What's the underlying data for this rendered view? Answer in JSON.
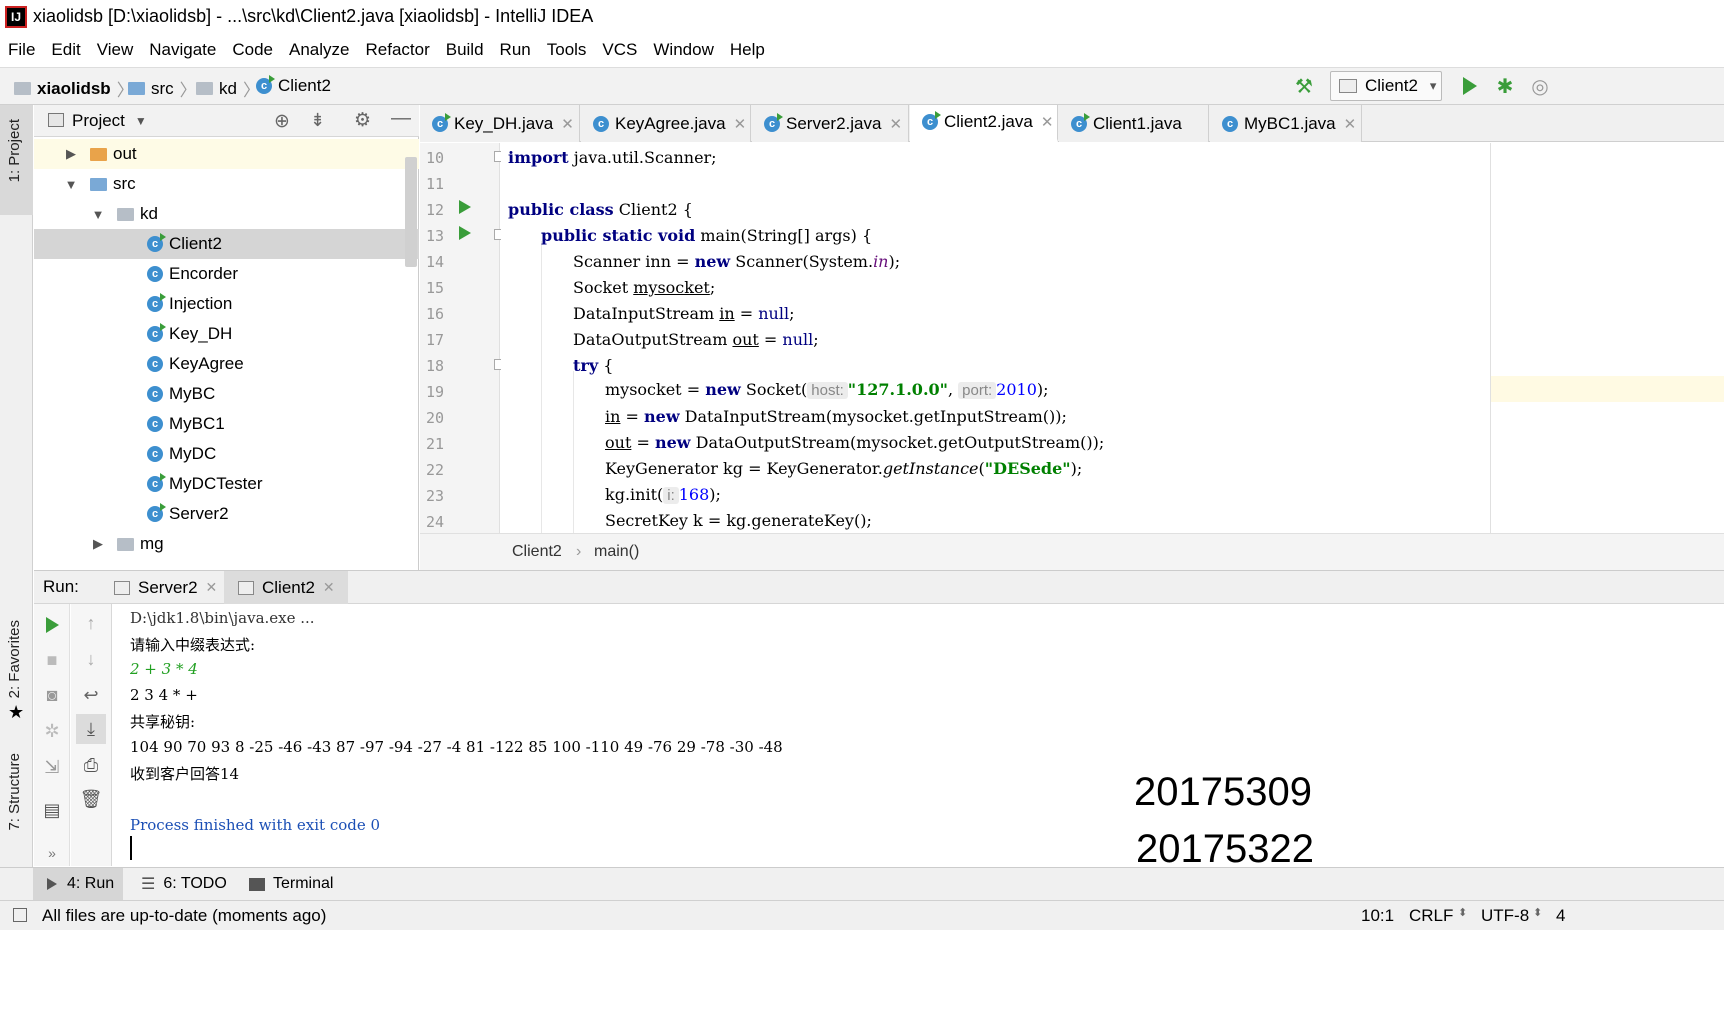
{
  "window": {
    "title": "xiaolidsb [D:\\xiaolidsb] - ...\\src\\kd\\Client2.java [xiaolidsb] - IntelliJ IDEA",
    "logo": "IJ"
  },
  "menu": [
    "File",
    "Edit",
    "View",
    "Navigate",
    "Code",
    "Analyze",
    "Refactor",
    "Build",
    "Run",
    "Tools",
    "VCS",
    "Window",
    "Help"
  ],
  "breadcrumb": {
    "project": "xiaolidsb",
    "folder1": "src",
    "folder2": "kd",
    "file": "Client2"
  },
  "run_config": {
    "label": "Client2"
  },
  "left_strip": {
    "project": "1: Project",
    "favorites": "2: Favorites",
    "structure": "7: Structure"
  },
  "project_panel": {
    "title": "Project",
    "tree": [
      {
        "label": "out",
        "icon": "folder-orange"
      },
      {
        "label": "src",
        "icon": "folder-blue"
      },
      {
        "label": "kd",
        "icon": "folder"
      },
      {
        "label": "Client2",
        "icon": "class-run"
      },
      {
        "label": "Encorder",
        "icon": "class"
      },
      {
        "label": "Injection",
        "icon": "class-run"
      },
      {
        "label": "Key_DH",
        "icon": "class-run"
      },
      {
        "label": "KeyAgree",
        "icon": "class"
      },
      {
        "label": "MyBC",
        "icon": "class"
      },
      {
        "label": "MyBC1",
        "icon": "class"
      },
      {
        "label": "MyDC",
        "icon": "class"
      },
      {
        "label": "MyDCTester",
        "icon": "class-run"
      },
      {
        "label": "Server2",
        "icon": "class-run"
      },
      {
        "label": "mg",
        "icon": "folder"
      }
    ]
  },
  "editor_tabs": [
    "Key_DH.java",
    "KeyAgree.java",
    "Server2.java",
    "Client2.java",
    "Client1.java",
    "MyBC1.java"
  ],
  "editor": {
    "line_numbers": [
      "10",
      "11",
      "12",
      "13",
      "14",
      "15",
      "16",
      "17",
      "18",
      "19",
      "20",
      "21",
      "22",
      "23",
      "24"
    ],
    "lines": {
      "l10": {
        "kw": "import",
        "rest": " java.util.Scanner;"
      },
      "l12": {
        "kw": "public class",
        "rest": " Client2 {"
      },
      "l13": {
        "kw": "public static void",
        "rest": " main(String[] args) {"
      },
      "l14": {
        "a": "Scanner inn = ",
        "kw": "new",
        "b": " Scanner(System.",
        "ital": "in",
        "c": ");"
      },
      "l15": {
        "a": "Socket ",
        "u": "mysocket",
        "c": ";"
      },
      "l16": {
        "a": "DataInputStream ",
        "u": "in",
        "b": " = ",
        "kw": "null",
        "c": ";"
      },
      "l17": {
        "a": "DataOutputStream ",
        "u": "out",
        "b": " = ",
        "kw": "null",
        "c": ";"
      },
      "l18": {
        "kw": "try",
        "c": " {"
      },
      "l19": {
        "a": "mysocket = ",
        "kw": "new",
        "b": " Socket(",
        "hint1": "host:",
        "str": "\"127.1.0.0\"",
        "sep": ", ",
        "hint2": "port:",
        "num": "2010",
        "c": ");"
      },
      "l20": {
        "u": "in",
        "b": " = ",
        "kw": "new",
        "c": " DataInputStream(mysocket.getInputStream());"
      },
      "l21": {
        "u": "out",
        "b": " = ",
        "kw": "new",
        "c": " DataOutputStream(mysocket.getOutputStream());"
      },
      "l22": {
        "a": "KeyGenerator kg = KeyGenerator.",
        "ital": "getInstance",
        "b": "(",
        "str": "\"DESede\"",
        "c": ");"
      },
      "l23": {
        "a": "kg.init(",
        "hint": "i:",
        "num": "168",
        "c": ");"
      },
      "l24": {
        "a": "SecretKey k = kg.generateKey();"
      }
    },
    "footer": {
      "class": "Client2",
      "method": "main()"
    }
  },
  "run_panel": {
    "label": "Run:",
    "tabs": [
      "Server2",
      "Client2"
    ],
    "console": [
      "D:\\jdk1.8\\bin\\java.exe ...",
      "请输入中缀表达式:",
      "2 + 3 * 4",
      "2 3 4 * +",
      "共享秘钥:",
      "104 90 70 93 8 -25 -46 -43 87 -97 -94 -27 -4 81 -122 85 100 -110 49 -76 29 -78 -30 -48",
      "收到客户回答14",
      "",
      "Process finished with exit code 0"
    ],
    "overlay_numbers": [
      "20175309",
      "20175322"
    ]
  },
  "bottom_tabs": [
    "4: Run",
    "6: TODO",
    "Terminal"
  ],
  "status": {
    "message": "All files are up-to-date (moments ago)",
    "position": "10:1",
    "line_sep": "CRLF",
    "encoding": "UTF-8",
    "indent": "4"
  },
  "colors": {
    "keyword": "#000080",
    "string": "#008000",
    "number": "#0000ff",
    "run_green": "#3a9d3a",
    "class_blue": "#3d8fcf"
  }
}
